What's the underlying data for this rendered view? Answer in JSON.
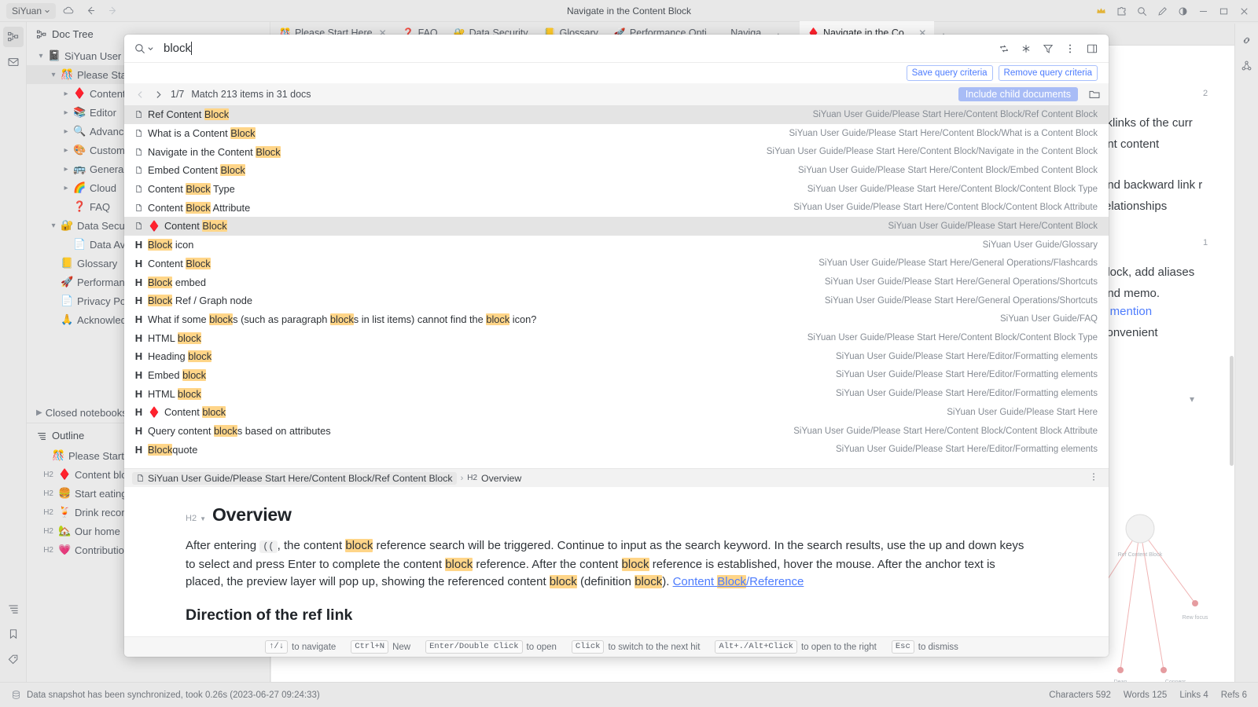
{
  "titlebar": {
    "workspace": "SiYuan",
    "title": "Navigate in the Content Block",
    "icons": {
      "cloud": "cloud-icon",
      "back": "arrow-left-icon",
      "forward": "arrow-right-icon",
      "crown": "crown-icon",
      "puzzle": "puzzle-icon",
      "search": "search-icon",
      "edit": "pencil-icon",
      "theme": "contrast-icon",
      "minimize": "minimize-icon",
      "maximize": "maximize-icon",
      "close": "close-icon"
    }
  },
  "leftdock": {
    "items": [
      {
        "name": "doc-tree-icon",
        "label": "Doc Tree"
      },
      {
        "name": "inbox-icon",
        "label": "Inbox"
      }
    ],
    "bottom": [
      {
        "name": "outline-icon",
        "label": "Outline"
      },
      {
        "name": "bookmark-icon",
        "label": "Bookmark"
      },
      {
        "name": "tag-icon",
        "label": "Tag"
      }
    ]
  },
  "sidebar": {
    "doc_tree": {
      "header": "Doc Tree",
      "header_icon": "doc-tree-icon",
      "rows": [
        {
          "indent": 0,
          "twisty": "down",
          "emoji": "📓",
          "label": "SiYuan User Guide",
          "selected": false
        },
        {
          "indent": 1,
          "twisty": "down",
          "emoji": "🎊",
          "label": "Please Start Here",
          "selected": true
        },
        {
          "indent": 2,
          "twisty": "right",
          "emoji": "♦️",
          "label": "Content Block",
          "selected": false
        },
        {
          "indent": 2,
          "twisty": "right",
          "emoji": "📚",
          "label": "Editor",
          "selected": false
        },
        {
          "indent": 2,
          "twisty": "right",
          "emoji": "🔍",
          "label": "Advanced",
          "selected": false
        },
        {
          "indent": 2,
          "twisty": "right",
          "emoji": "🎨",
          "label": "Customize",
          "selected": false
        },
        {
          "indent": 2,
          "twisty": "right",
          "emoji": "🚌",
          "label": "General Operations",
          "selected": false
        },
        {
          "indent": 2,
          "twisty": "right",
          "emoji": "🌈",
          "label": "Cloud",
          "selected": false
        },
        {
          "indent": 2,
          "twisty": "none",
          "emoji": "❓",
          "label": "FAQ",
          "selected": false
        },
        {
          "indent": 1,
          "twisty": "down",
          "emoji": "🔐",
          "label": "Data Security",
          "selected": false
        },
        {
          "indent": 2,
          "twisty": "none",
          "emoji": "📄",
          "label": "Data Availability",
          "selected": false
        },
        {
          "indent": 1,
          "twisty": "none",
          "emoji": "📒",
          "label": "Glossary",
          "selected": false
        },
        {
          "indent": 1,
          "twisty": "none",
          "emoji": "🚀",
          "label": "Performance Optimization",
          "selected": false
        },
        {
          "indent": 1,
          "twisty": "none",
          "emoji": "📄",
          "label": "Privacy Policy",
          "selected": false
        },
        {
          "indent": 1,
          "twisty": "none",
          "emoji": "🙏",
          "label": "Acknowledgement",
          "selected": false
        }
      ],
      "closed_notebooks": "Closed notebooks"
    },
    "outline": {
      "header": "Outline",
      "header_icon": "outline-icon",
      "rows": [
        {
          "level": "",
          "emoji": "🎊",
          "label": "Please Start Here"
        },
        {
          "level": "H2",
          "emoji": "♦️",
          "label": "Content block"
        },
        {
          "level": "H2",
          "emoji": "🍔",
          "label": "Start eating"
        },
        {
          "level": "H2",
          "emoji": "🍹",
          "label": "Drink record"
        },
        {
          "level": "H2",
          "emoji": "🏡",
          "label": "Our home"
        },
        {
          "level": "H2",
          "emoji": "💗",
          "label": "Contribution"
        }
      ]
    }
  },
  "tabs": [
    {
      "emoji": "🎊",
      "label": "Please Start Here",
      "active": false,
      "closable": true
    },
    {
      "emoji": "❓",
      "label": "FAQ",
      "active": false,
      "closable": false
    },
    {
      "emoji": "🔐",
      "label": "Data Security",
      "active": false,
      "closable": false
    },
    {
      "emoji": "📒",
      "label": "Glossary",
      "active": false,
      "closable": false
    },
    {
      "emoji": "🚀",
      "label": "Performance Opti...",
      "active": false,
      "closable": false
    },
    {
      "emoji": "",
      "label": "Naviga",
      "active": false,
      "closable": false
    },
    {
      "emoji": "♦️",
      "label": "Navigate in the Co...",
      "active": true,
      "closable": true
    }
  ],
  "editor_bg": {
    "lines": [
      "cklinks of the curr",
      "ent content",
      "and backward link r",
      "relationships",
      "block, add aliases",
      "and memo.",
      "k mention",
      "convenient"
    ],
    "badges": [
      "2",
      "1"
    ],
    "graph_labels": [
      "Ref Content Block",
      "Rew focus",
      "Dean",
      "Conners"
    ]
  },
  "search_dialog": {
    "query": "block",
    "placeholder": "Search",
    "icons": {
      "search": "search-icon",
      "chevron_down": "chevron-down-icon",
      "replace": "replace-icon",
      "asterisk": "asterisk-icon",
      "filter": "filter-icon",
      "more": "more-vertical-icon",
      "layout": "layout-panel-icon",
      "folder": "folder-icon"
    },
    "criteria": {
      "save": "Save query criteria",
      "remove": "Remove query criteria"
    },
    "nav": {
      "prev_icon": "chevron-left-icon",
      "next_icon": "chevron-right-icon",
      "page": "1/7",
      "match_text": "Match 213 items in 31 docs",
      "include_child": "Include child documents"
    },
    "results": [
      {
        "type": "doc",
        "emoji": "",
        "pre": "Ref Content ",
        "hit": "Block",
        "post": "",
        "path": "SiYuan User Guide/Please Start Here/Content Block/Ref Content Block",
        "selected": true
      },
      {
        "type": "doc",
        "emoji": "",
        "pre": "What is a Content ",
        "hit": "Block",
        "post": "",
        "path": "SiYuan User Guide/Please Start Here/Content Block/What is a Content Block",
        "selected": false
      },
      {
        "type": "doc",
        "emoji": "",
        "pre": "Navigate in the Content ",
        "hit": "Block",
        "post": "",
        "path": "SiYuan User Guide/Please Start Here/Content Block/Navigate in the Content Block",
        "selected": false
      },
      {
        "type": "doc",
        "emoji": "",
        "pre": "Embed Content ",
        "hit": "Block",
        "post": "",
        "path": "SiYuan User Guide/Please Start Here/Content Block/Embed Content Block",
        "selected": false
      },
      {
        "type": "doc",
        "emoji": "",
        "pre": "Content ",
        "hit": "Block",
        "post": " Type",
        "path": "SiYuan User Guide/Please Start Here/Content Block/Content Block Type",
        "selected": false
      },
      {
        "type": "doc",
        "emoji": "",
        "pre": "Content ",
        "hit": "Block",
        "post": " Attribute",
        "path": "SiYuan User Guide/Please Start Here/Content Block/Content Block Attribute",
        "selected": false
      },
      {
        "type": "doc",
        "emoji": "♦️",
        "pre": "Content ",
        "hit": "Block",
        "post": "",
        "path": "SiYuan User Guide/Please Start Here/Content Block",
        "selected": true
      },
      {
        "type": "h",
        "emoji": "",
        "pre": "",
        "hit": "Block",
        "post": " icon",
        "path": "SiYuan User Guide/Glossary",
        "selected": false
      },
      {
        "type": "h",
        "emoji": "",
        "pre": "Content ",
        "hit": "Block",
        "post": "",
        "path": "SiYuan User Guide/Please Start Here/General Operations/Flashcards",
        "selected": false
      },
      {
        "type": "h",
        "emoji": "",
        "pre": "",
        "hit": "Block",
        "post": " embed",
        "path": "SiYuan User Guide/Please Start Here/General Operations/Shortcuts",
        "selected": false
      },
      {
        "type": "h",
        "emoji": "",
        "pre": "",
        "hit": "Block",
        "post": " Ref / Graph node",
        "path": "SiYuan User Guide/Please Start Here/General Operations/Shortcuts",
        "selected": false
      },
      {
        "type": "h",
        "emoji": "",
        "pre": "What if some ",
        "hit": "block",
        "post": "",
        "path": "SiYuan User Guide/FAQ",
        "selected": false,
        "rich": [
          {
            "t": "What if some ",
            "h": false
          },
          {
            "t": "block",
            "h": true
          },
          {
            "t": "s (such as paragraph ",
            "h": false
          },
          {
            "t": "block",
            "h": true
          },
          {
            "t": "s in list items) cannot find the ",
            "h": false
          },
          {
            "t": "block",
            "h": true
          },
          {
            "t": " icon?",
            "h": false
          }
        ]
      },
      {
        "type": "h",
        "emoji": "",
        "pre": "HTML ",
        "hit": "block",
        "post": "",
        "path": "SiYuan User Guide/Please Start Here/Content Block/Content Block Type",
        "selected": false
      },
      {
        "type": "h",
        "emoji": "",
        "pre": "Heading ",
        "hit": "block",
        "post": "",
        "path": "SiYuan User Guide/Please Start Here/Editor/Formatting elements",
        "selected": false
      },
      {
        "type": "h",
        "emoji": "",
        "pre": "Embed ",
        "hit": "block",
        "post": "",
        "path": "SiYuan User Guide/Please Start Here/Editor/Formatting elements",
        "selected": false
      },
      {
        "type": "h",
        "emoji": "",
        "pre": "HTML ",
        "hit": "block",
        "post": "",
        "path": "SiYuan User Guide/Please Start Here/Editor/Formatting elements",
        "selected": false
      },
      {
        "type": "h",
        "emoji": "♦️",
        "pre": "Content ",
        "hit": "block",
        "post": "",
        "path": "SiYuan User Guide/Please Start Here",
        "selected": false
      },
      {
        "type": "h",
        "emoji": "",
        "pre": "Query content ",
        "hit": "block",
        "post": "s based on attributes",
        "path": "SiYuan User Guide/Please Start Here/Content Block/Content Block Attribute",
        "selected": false
      },
      {
        "type": "h",
        "emoji": "",
        "pre": "",
        "hit": "Block",
        "post": "quote",
        "path": "SiYuan User Guide/Please Start Here/Editor/Formatting elements",
        "selected": false
      }
    ],
    "preview": {
      "breadcrumb_doc": "SiYuan User Guide/Please Start Here/Content Block/Ref Content Block",
      "breadcrumb_sep": "›",
      "breadcrumb_level": "H2",
      "breadcrumb_heading": "Overview",
      "more_icon": "more-vertical-icon",
      "h2_mark": "H2",
      "heading": "Overview",
      "paragraph": [
        {
          "t": "After entering ",
          "h": false,
          "kbd": false
        },
        {
          "t": "((",
          "h": false,
          "kbd": true
        },
        {
          "t": ", the content ",
          "h": false,
          "kbd": false
        },
        {
          "t": "block",
          "h": true,
          "kbd": false
        },
        {
          "t": " reference search will be triggered. Continue to input as the search keyword. In the search results, use the up and down keys to select and press Enter to complete the content ",
          "h": false,
          "kbd": false
        },
        {
          "t": "block",
          "h": true,
          "kbd": false
        },
        {
          "t": " reference. After the content ",
          "h": false,
          "kbd": false
        },
        {
          "t": "block",
          "h": true,
          "kbd": false
        },
        {
          "t": " reference is established, hover the mouse. After the anchor text is placed, the preview layer will pop up, showing the referenced content ",
          "h": false,
          "kbd": false
        },
        {
          "t": "block",
          "h": true,
          "kbd": false
        },
        {
          "t": " (definition ",
          "h": false,
          "kbd": false
        },
        {
          "t": "block",
          "h": true,
          "kbd": false
        },
        {
          "t": "). ",
          "h": false,
          "kbd": false
        },
        {
          "t": "Content Block",
          "h": false,
          "kbd": false,
          "link": true,
          "linkhit": "Block"
        },
        {
          "t": "/Reference",
          "h": false,
          "kbd": false,
          "link": true
        }
      ],
      "subheading": "Direction of the ref link"
    },
    "footer_hints": [
      {
        "key": "↑/↓",
        "text": "to navigate"
      },
      {
        "key": "Ctrl+N",
        "text": "New"
      },
      {
        "key": "Enter/Double Click",
        "text": "to open"
      },
      {
        "key": "Click",
        "text": "to switch to the next hit"
      },
      {
        "key": "Alt+./Alt+Click",
        "text": "to open to the right"
      },
      {
        "key": "Esc",
        "text": "to dismiss"
      }
    ]
  },
  "statusbar": {
    "icon": "database-icon",
    "message": "Data snapshot has been synchronized, took 0.26s (2023-06-27 09:24:33)",
    "stats": [
      "Characters 592",
      "Words 125",
      "Links 4",
      "Refs 6"
    ]
  }
}
